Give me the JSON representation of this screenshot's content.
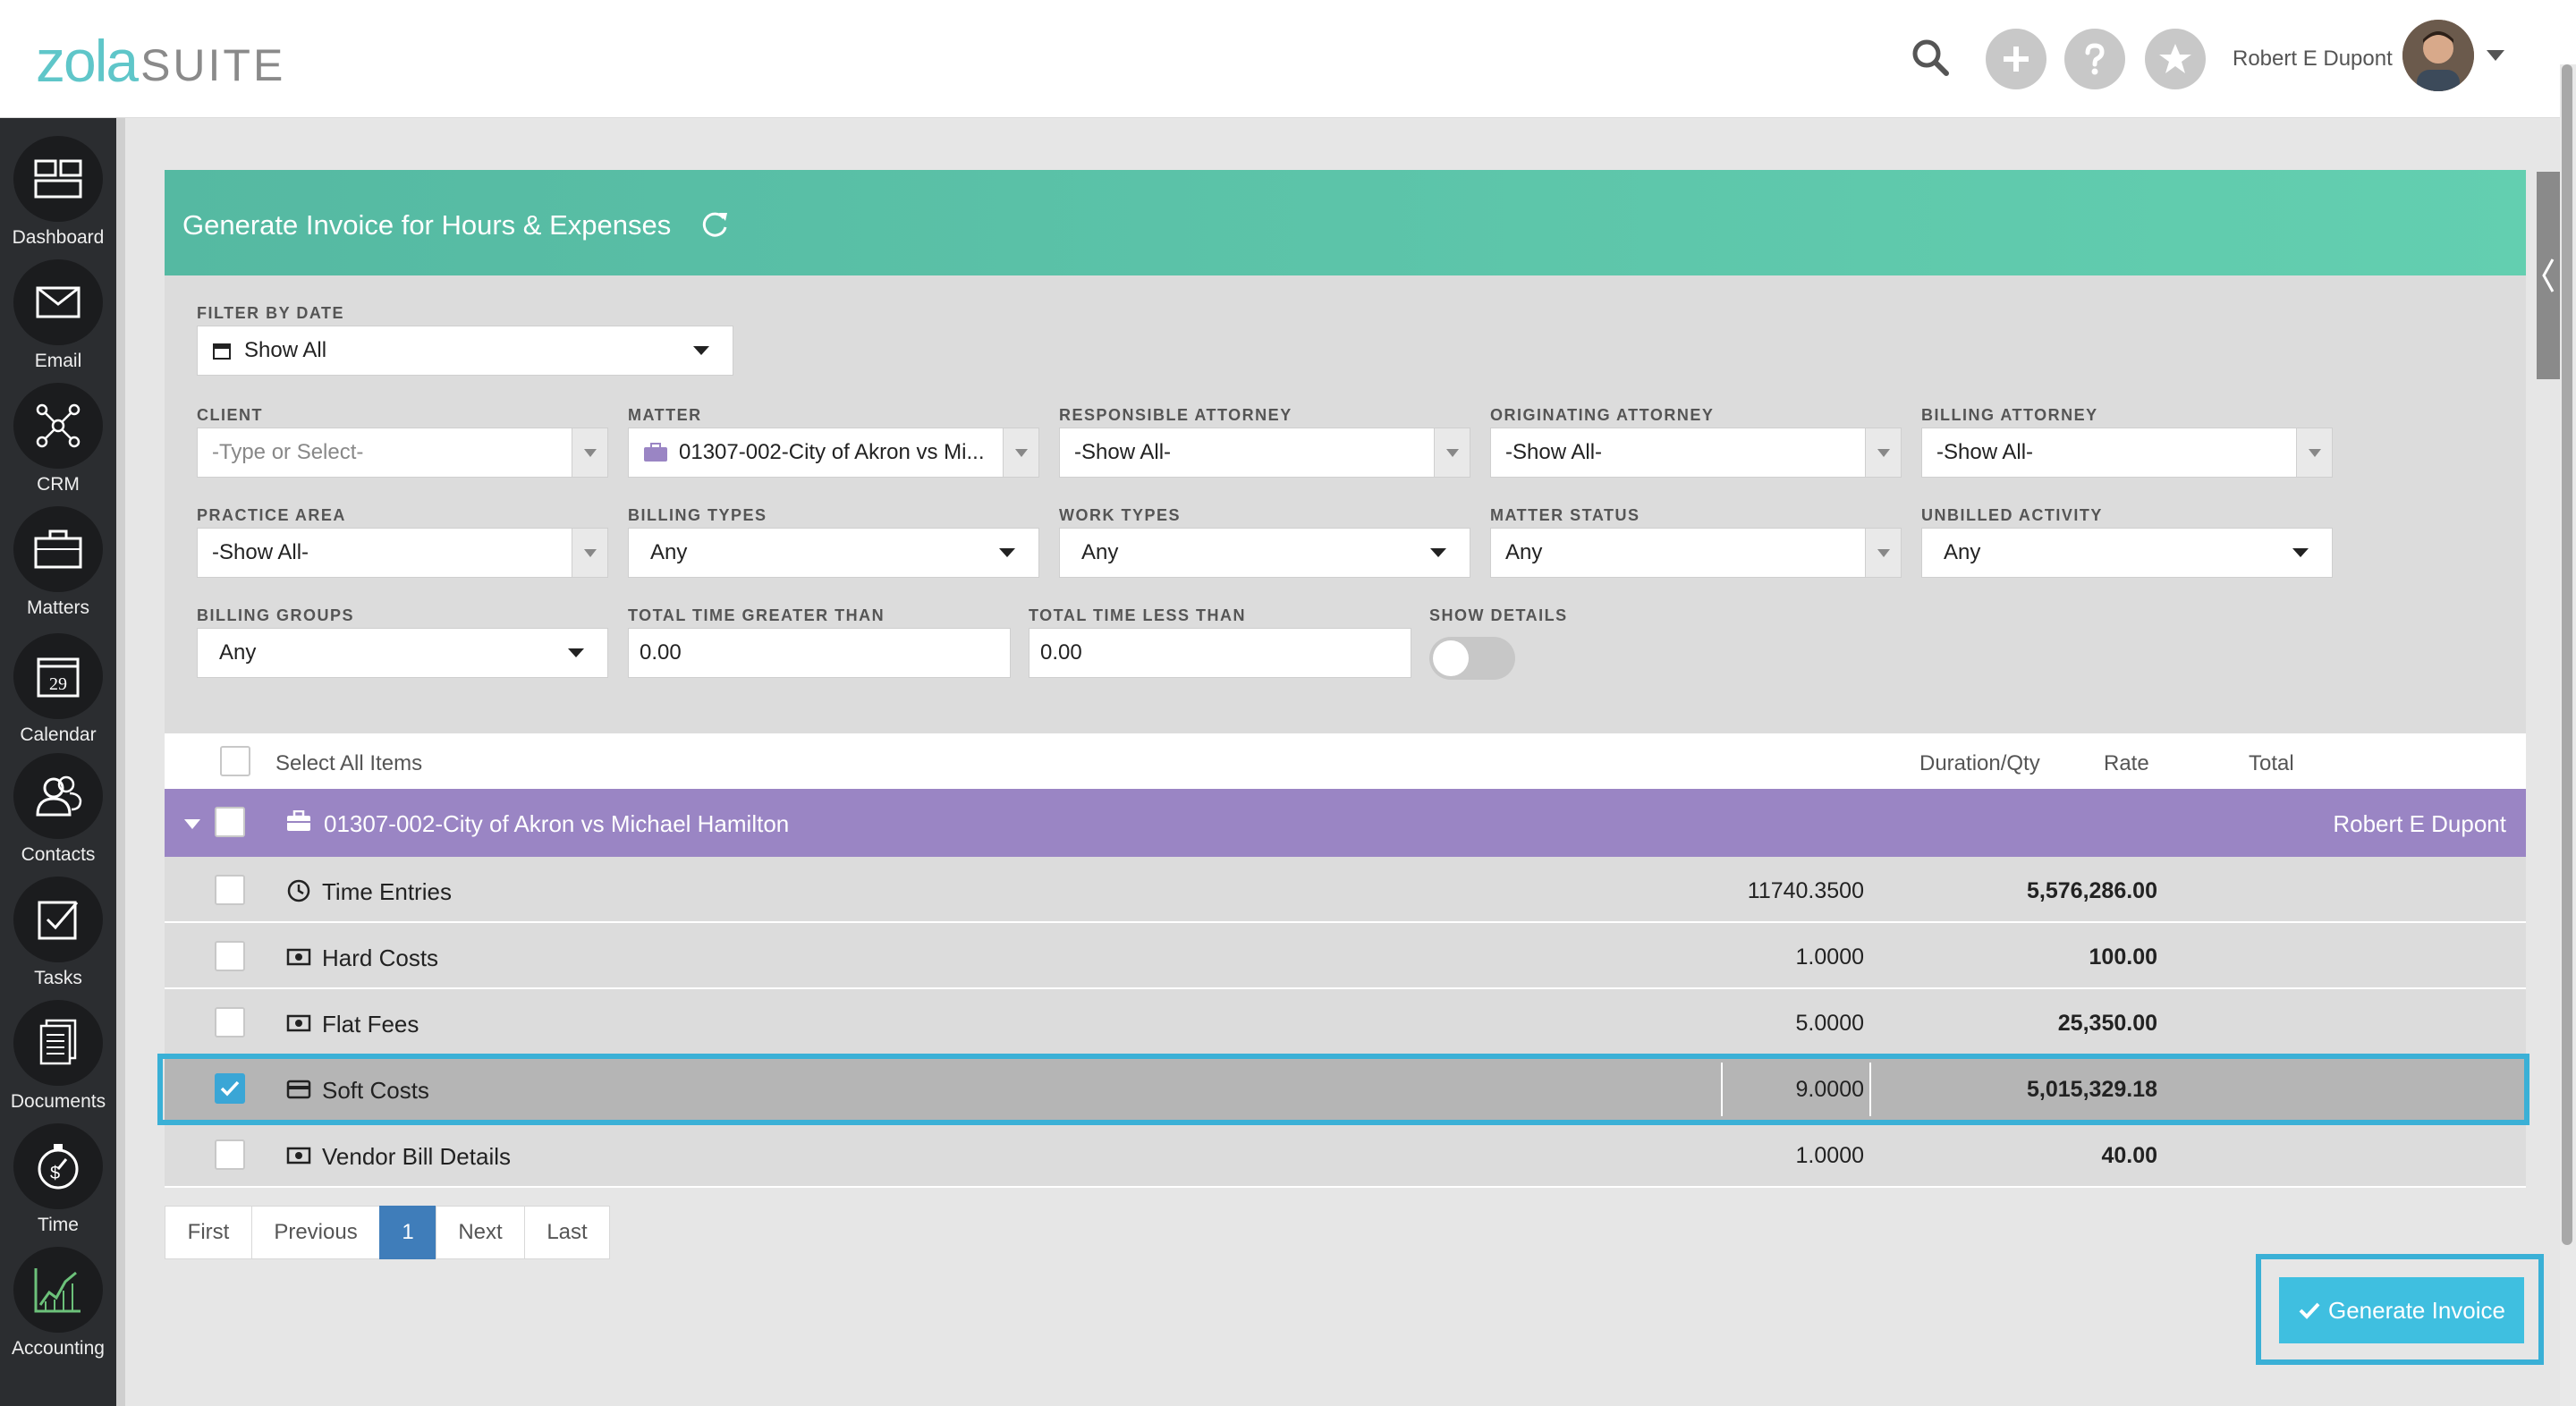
{
  "app": {
    "logo_primary": "zola",
    "logo_secondary": "SUITE",
    "accent": "#5fc6c9"
  },
  "topbar": {
    "user_name": "Robert E Dupont"
  },
  "sidebar": {
    "items": [
      {
        "label": "Dashboard"
      },
      {
        "label": "Email"
      },
      {
        "label": "CRM"
      },
      {
        "label": "Matters"
      },
      {
        "label": "Calendar",
        "badge": "29"
      },
      {
        "label": "Contacts"
      },
      {
        "label": "Tasks"
      },
      {
        "label": "Documents"
      },
      {
        "label": "Time"
      },
      {
        "label": "Accounting"
      }
    ]
  },
  "panel": {
    "title": "Generate Invoice for Hours & Expenses"
  },
  "filters": {
    "date": {
      "label": "FILTER BY DATE",
      "value": "Show All"
    },
    "client": {
      "label": "CLIENT",
      "placeholder": "-Type or Select-"
    },
    "matter": {
      "label": "MATTER",
      "value": "01307-002-City of Akron vs Mi..."
    },
    "responsible_attorney": {
      "label": "RESPONSIBLE ATTORNEY",
      "value": "-Show All-"
    },
    "originating_attorney": {
      "label": "ORIGINATING ATTORNEY",
      "value": "-Show All-"
    },
    "billing_attorney": {
      "label": "BILLING ATTORNEY",
      "value": "-Show All-"
    },
    "practice_area": {
      "label": "PRACTICE AREA",
      "value": "-Show All-"
    },
    "billing_types": {
      "label": "BILLING TYPES",
      "value": "Any"
    },
    "work_types": {
      "label": "WORK TYPES",
      "value": "Any"
    },
    "matter_status": {
      "label": "MATTER STATUS",
      "value": "Any"
    },
    "unbilled_activity": {
      "label": "UNBILLED ACTIVITY",
      "value": "Any"
    },
    "billing_groups": {
      "label": "BILLING GROUPS",
      "value": "Any"
    },
    "time_greater": {
      "label": "TOTAL TIME GREATER THAN",
      "value": "0.00"
    },
    "time_less": {
      "label": "TOTAL TIME LESS THAN",
      "value": "0.00"
    },
    "show_details": {
      "label": "SHOW DETAILS",
      "on": false
    }
  },
  "table": {
    "select_all": "Select All Items",
    "columns": {
      "duration": "Duration/Qty",
      "rate": "Rate",
      "total": "Total"
    },
    "group": {
      "matter": "01307-002-City of Akron vs Michael Hamilton",
      "attorney": "Robert E Dupont"
    },
    "rows": [
      {
        "name": "Time Entries",
        "qty": "11740.3500",
        "amount": "5,576,286.00",
        "icon": "clock-icon",
        "checked": false
      },
      {
        "name": "Hard Costs",
        "qty": "1.0000",
        "amount": "100.00",
        "icon": "money-icon",
        "checked": false
      },
      {
        "name": "Flat Fees",
        "qty": "5.0000",
        "amount": "25,350.00",
        "icon": "money-icon",
        "checked": false
      },
      {
        "name": "Soft Costs",
        "qty": "9.0000",
        "amount": "5,015,329.18",
        "icon": "card-icon",
        "checked": true
      },
      {
        "name": "Vendor Bill Details",
        "qty": "1.0000",
        "amount": "40.00",
        "icon": "money-icon",
        "checked": false
      }
    ]
  },
  "pager": {
    "first": "First",
    "previous": "Previous",
    "current": "1",
    "next": "Next",
    "last": "Last"
  },
  "actions": {
    "generate": "Generate Invoice"
  }
}
